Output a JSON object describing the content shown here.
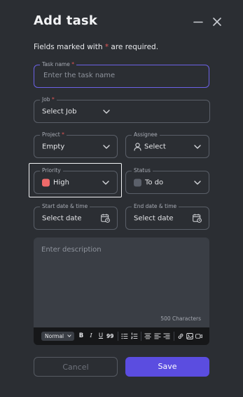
{
  "dialog": {
    "title": "Add task",
    "required_note_pre": "Fields marked with ",
    "required_star": "*",
    "required_note_post": " are required."
  },
  "fields": {
    "task_name": {
      "label": "Task name",
      "star": "*",
      "placeholder": "Enter the task name",
      "value": ""
    },
    "job": {
      "label": "Job",
      "star": "*",
      "value": "Select Job"
    },
    "project": {
      "label": "Project",
      "star": "*",
      "value": "Empty"
    },
    "assignee": {
      "label": "Assignee",
      "value": "Select"
    },
    "priority": {
      "label": "Priority",
      "value": "High",
      "color": "#ef6a6a"
    },
    "status": {
      "label": "Status",
      "value": "To do",
      "color": "#5b606a"
    },
    "start_date": {
      "label": "Start date & time",
      "value": "Select date"
    },
    "end_date": {
      "label": "End date & time",
      "value": "Select date"
    }
  },
  "description": {
    "placeholder": "Enter description",
    "char_count": "500 Characters"
  },
  "toolbar": {
    "format": "Normal",
    "bold": "B",
    "italic": "I",
    "underline": "U",
    "quote": "99"
  },
  "buttons": {
    "cancel": "Cancel",
    "save": "Save"
  },
  "colors": {
    "accent": "#5b4de0",
    "required": "#e35757",
    "background": "#2b2e33"
  }
}
